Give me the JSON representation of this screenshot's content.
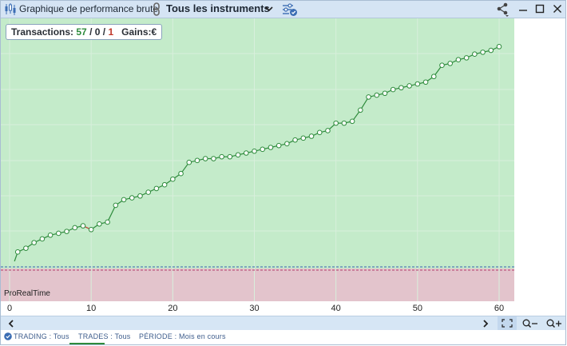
{
  "titlebar": {
    "title": "Graphique de performance brute",
    "instrument": "Tous les instruments",
    "icons": [
      "candlestick-icon",
      "link-icon",
      "chevron-down-icon",
      "filter-settings-icon",
      "share-icon",
      "minimize-icon",
      "maximize-icon",
      "close-icon"
    ]
  },
  "summary": {
    "transactions_label": "Transactions:",
    "wins": "57",
    "neutral": "0",
    "losses": "1",
    "separator": " / ",
    "gains_label": "Gains:",
    "gains_value": "€"
  },
  "brand": "ProRealTime",
  "colors": {
    "profit_zone": "#c4ebca",
    "loss_zone": "#e3c4cc",
    "line": "#2e8b3c",
    "loss_segment": "#c0392b",
    "wins_text": "#2e8b3c",
    "losses_text": "#c0392b",
    "accent": "#3e5d8c"
  },
  "statusbar": {
    "trading_label": "TRADING",
    "trading_value": "Tous",
    "trades_label": "TRADES",
    "trades_value": "Tous",
    "period_label": "PÉRIODE",
    "period_value": "Mois en cours",
    "sep": " : "
  },
  "scrollbar": {
    "left_icon": "chevron-left-icon",
    "right_icon": "chevron-right-icon",
    "fit_icon": "fit-screen-icon",
    "zoom_out_icon": "zoom-out-icon",
    "zoom_in_icon": "zoom-in-icon"
  },
  "chart_data": {
    "type": "line",
    "x": [
      1,
      2,
      3,
      4,
      5,
      6,
      7,
      8,
      9,
      10,
      11,
      12,
      13,
      14,
      15,
      16,
      17,
      18,
      19,
      20,
      21,
      22,
      23,
      24,
      25,
      26,
      27,
      28,
      29,
      30,
      31,
      32,
      33,
      34,
      35,
      36,
      37,
      38,
      39,
      40,
      41,
      42,
      43,
      44,
      45,
      46,
      47,
      48,
      49,
      50,
      51,
      52,
      53,
      54,
      55,
      56,
      57,
      58
    ],
    "values": [
      3,
      8,
      10,
      13,
      15,
      17,
      18,
      19,
      21,
      22,
      20,
      23,
      24,
      33,
      36,
      37,
      38,
      40,
      42,
      44,
      47,
      50,
      56,
      57,
      58,
      58,
      59,
      59,
      60,
      61,
      62,
      63,
      64,
      65,
      66,
      68,
      69,
      70,
      72,
      73,
      77,
      77,
      78,
      84,
      91,
      92,
      93,
      95,
      96,
      97,
      98,
      99,
      102,
      108,
      109,
      111,
      112,
      114,
      115,
      116,
      118
    ],
    "xlim": [
      0,
      61
    ],
    "ylim": [
      -3,
      128
    ],
    "xticks": [
      0,
      10,
      20,
      30,
      40,
      50,
      60
    ],
    "grid": true,
    "baseline": 0
  }
}
